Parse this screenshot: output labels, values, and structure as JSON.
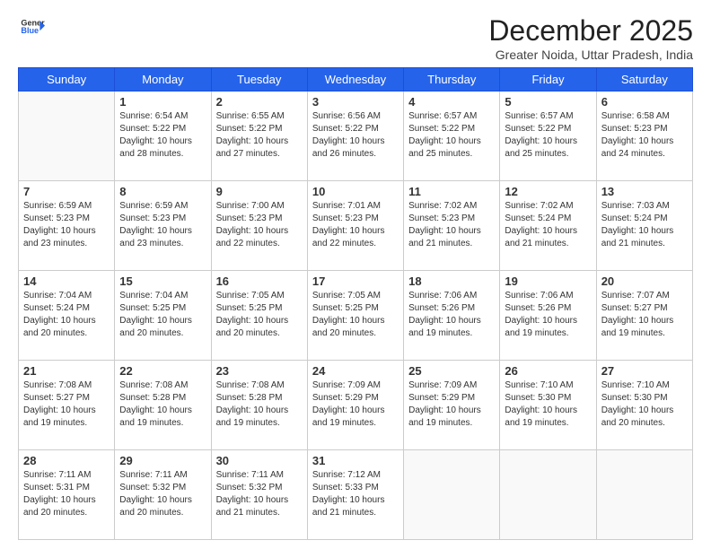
{
  "header": {
    "logo_line1": "General",
    "logo_line2": "Blue",
    "month": "December 2025",
    "location": "Greater Noida, Uttar Pradesh, India"
  },
  "weekdays": [
    "Sunday",
    "Monday",
    "Tuesday",
    "Wednesday",
    "Thursday",
    "Friday",
    "Saturday"
  ],
  "weeks": [
    [
      {
        "day": "",
        "info": ""
      },
      {
        "day": "1",
        "info": "Sunrise: 6:54 AM\nSunset: 5:22 PM\nDaylight: 10 hours\nand 28 minutes."
      },
      {
        "day": "2",
        "info": "Sunrise: 6:55 AM\nSunset: 5:22 PM\nDaylight: 10 hours\nand 27 minutes."
      },
      {
        "day": "3",
        "info": "Sunrise: 6:56 AM\nSunset: 5:22 PM\nDaylight: 10 hours\nand 26 minutes."
      },
      {
        "day": "4",
        "info": "Sunrise: 6:57 AM\nSunset: 5:22 PM\nDaylight: 10 hours\nand 25 minutes."
      },
      {
        "day": "5",
        "info": "Sunrise: 6:57 AM\nSunset: 5:22 PM\nDaylight: 10 hours\nand 25 minutes."
      },
      {
        "day": "6",
        "info": "Sunrise: 6:58 AM\nSunset: 5:23 PM\nDaylight: 10 hours\nand 24 minutes."
      }
    ],
    [
      {
        "day": "7",
        "info": "Sunrise: 6:59 AM\nSunset: 5:23 PM\nDaylight: 10 hours\nand 23 minutes."
      },
      {
        "day": "8",
        "info": "Sunrise: 6:59 AM\nSunset: 5:23 PM\nDaylight: 10 hours\nand 23 minutes."
      },
      {
        "day": "9",
        "info": "Sunrise: 7:00 AM\nSunset: 5:23 PM\nDaylight: 10 hours\nand 22 minutes."
      },
      {
        "day": "10",
        "info": "Sunrise: 7:01 AM\nSunset: 5:23 PM\nDaylight: 10 hours\nand 22 minutes."
      },
      {
        "day": "11",
        "info": "Sunrise: 7:02 AM\nSunset: 5:23 PM\nDaylight: 10 hours\nand 21 minutes."
      },
      {
        "day": "12",
        "info": "Sunrise: 7:02 AM\nSunset: 5:24 PM\nDaylight: 10 hours\nand 21 minutes."
      },
      {
        "day": "13",
        "info": "Sunrise: 7:03 AM\nSunset: 5:24 PM\nDaylight: 10 hours\nand 21 minutes."
      }
    ],
    [
      {
        "day": "14",
        "info": "Sunrise: 7:04 AM\nSunset: 5:24 PM\nDaylight: 10 hours\nand 20 minutes."
      },
      {
        "day": "15",
        "info": "Sunrise: 7:04 AM\nSunset: 5:25 PM\nDaylight: 10 hours\nand 20 minutes."
      },
      {
        "day": "16",
        "info": "Sunrise: 7:05 AM\nSunset: 5:25 PM\nDaylight: 10 hours\nand 20 minutes."
      },
      {
        "day": "17",
        "info": "Sunrise: 7:05 AM\nSunset: 5:25 PM\nDaylight: 10 hours\nand 20 minutes."
      },
      {
        "day": "18",
        "info": "Sunrise: 7:06 AM\nSunset: 5:26 PM\nDaylight: 10 hours\nand 19 minutes."
      },
      {
        "day": "19",
        "info": "Sunrise: 7:06 AM\nSunset: 5:26 PM\nDaylight: 10 hours\nand 19 minutes."
      },
      {
        "day": "20",
        "info": "Sunrise: 7:07 AM\nSunset: 5:27 PM\nDaylight: 10 hours\nand 19 minutes."
      }
    ],
    [
      {
        "day": "21",
        "info": "Sunrise: 7:08 AM\nSunset: 5:27 PM\nDaylight: 10 hours\nand 19 minutes."
      },
      {
        "day": "22",
        "info": "Sunrise: 7:08 AM\nSunset: 5:28 PM\nDaylight: 10 hours\nand 19 minutes."
      },
      {
        "day": "23",
        "info": "Sunrise: 7:08 AM\nSunset: 5:28 PM\nDaylight: 10 hours\nand 19 minutes."
      },
      {
        "day": "24",
        "info": "Sunrise: 7:09 AM\nSunset: 5:29 PM\nDaylight: 10 hours\nand 19 minutes."
      },
      {
        "day": "25",
        "info": "Sunrise: 7:09 AM\nSunset: 5:29 PM\nDaylight: 10 hours\nand 19 minutes."
      },
      {
        "day": "26",
        "info": "Sunrise: 7:10 AM\nSunset: 5:30 PM\nDaylight: 10 hours\nand 19 minutes."
      },
      {
        "day": "27",
        "info": "Sunrise: 7:10 AM\nSunset: 5:30 PM\nDaylight: 10 hours\nand 20 minutes."
      }
    ],
    [
      {
        "day": "28",
        "info": "Sunrise: 7:11 AM\nSunset: 5:31 PM\nDaylight: 10 hours\nand 20 minutes."
      },
      {
        "day": "29",
        "info": "Sunrise: 7:11 AM\nSunset: 5:32 PM\nDaylight: 10 hours\nand 20 minutes."
      },
      {
        "day": "30",
        "info": "Sunrise: 7:11 AM\nSunset: 5:32 PM\nDaylight: 10 hours\nand 21 minutes."
      },
      {
        "day": "31",
        "info": "Sunrise: 7:12 AM\nSunset: 5:33 PM\nDaylight: 10 hours\nand 21 minutes."
      },
      {
        "day": "",
        "info": ""
      },
      {
        "day": "",
        "info": ""
      },
      {
        "day": "",
        "info": ""
      }
    ]
  ]
}
